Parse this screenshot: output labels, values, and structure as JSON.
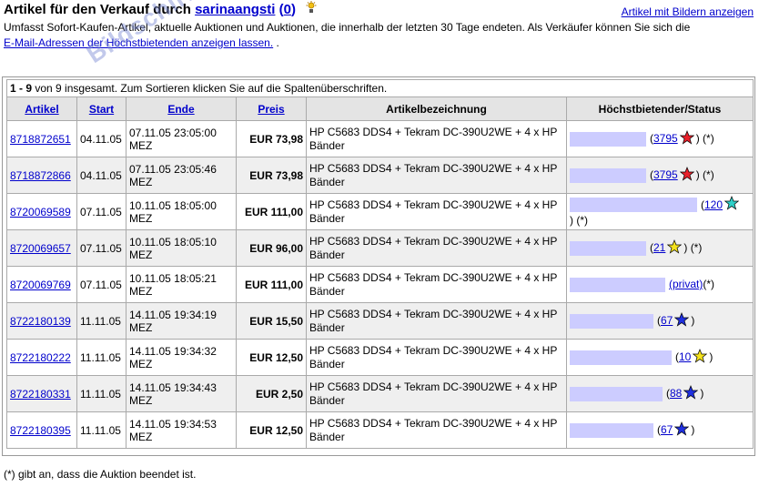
{
  "header": {
    "title_prefix": "Artikel für den Verkauf durch",
    "seller": "sarinaangsti",
    "score_open": "(",
    "score": "0",
    "score_close": ")",
    "pics_link": "Artikel mit Bildern anzeigen",
    "desc_text": "Umfasst Sofort-Kaufen-Artikel, aktuelle Auktionen und Auktionen, die innerhalb der letzten 30 Tage endeten. Als Verkäufer können Sie sich die",
    "email_link": "E-Mail-Adressen der Höchstbietenden anzeigen lassen.",
    "desc_end": "."
  },
  "info": {
    "range": "1 - 9",
    "text": "von 9 insgesamt. Zum Sortieren klicken Sie auf die Spaltenüberschriften."
  },
  "columns": {
    "item": "Artikel",
    "start": "Start",
    "end": "Ende",
    "price": "Preis",
    "title": "Artikelbezeichnung",
    "bidder": "Höchstbietender/Status"
  },
  "rows": [
    {
      "item": "8718872651",
      "start": "04.11.05",
      "end": "07.11.05 23:05:00 MEZ",
      "price": "EUR 73,98",
      "title": "HP C5683 DDS4 + Tekram DC-390U2WE + 4 x HP Bänder",
      "bid_open": "(",
      "rating": "3795",
      "star": "red",
      "bid_tail": ") (*)",
      "bar": 0.6
    },
    {
      "item": "8718872866",
      "start": "04.11.05",
      "end": "07.11.05 23:05:46 MEZ",
      "price": "EUR 73,98",
      "title": "HP C5683 DDS4 + Tekram DC-390U2WE + 4 x HP Bänder",
      "bid_open": "(",
      "rating": "3795",
      "star": "red",
      "bid_tail": ") (*)",
      "bar": 0.6
    },
    {
      "item": "8720069589",
      "start": "07.11.05",
      "end": "10.11.05 18:05:00 MEZ",
      "price": "EUR 111,00",
      "title": "HP C5683 DDS4 + Tekram DC-390U2WE + 4 x HP Bänder",
      "bid_open": "(",
      "rating": "120",
      "star": "turquoise",
      "bid_tail": ") (*)",
      "bar": 1.0
    },
    {
      "item": "8720069657",
      "start": "07.11.05",
      "end": "10.11.05 18:05:10 MEZ",
      "price": "EUR 96,00",
      "title": "HP C5683 DDS4 + Tekram DC-390U2WE + 4 x HP Bänder",
      "bid_open": "(",
      "rating": "21",
      "star": "yellow",
      "bid_tail": ") (*)",
      "bar": 0.6
    },
    {
      "item": "8720069769",
      "start": "07.11.05",
      "end": "10.11.05 18:05:21 MEZ",
      "price": "EUR 111,00",
      "title": "HP C5683 DDS4 + Tekram DC-390U2WE + 4 x HP Bänder",
      "bid_open": "",
      "rating": "(privat)",
      "star": "",
      "bid_tail": "(*)",
      "bar": 0.75
    },
    {
      "item": "8722180139",
      "start": "11.11.05",
      "end": "14.11.05 19:34:19 MEZ",
      "price": "EUR 15,50",
      "title": "HP C5683 DDS4 + Tekram DC-390U2WE + 4 x HP Bänder",
      "bid_open": "(",
      "rating": "67",
      "star": "blue",
      "bid_tail": ")",
      "bar": 0.66
    },
    {
      "item": "8722180222",
      "start": "11.11.05",
      "end": "14.11.05 19:34:32 MEZ",
      "price": "EUR 12,50",
      "title": "HP C5683 DDS4 + Tekram DC-390U2WE + 4 x HP Bänder",
      "bid_open": "(",
      "rating": "10",
      "star": "yellow",
      "bid_tail": ")",
      "bar": 0.8
    },
    {
      "item": "8722180331",
      "start": "11.11.05",
      "end": "14.11.05 19:34:43 MEZ",
      "price": "EUR 2,50",
      "title": "HP C5683 DDS4 + Tekram DC-390U2WE + 4 x HP Bänder",
      "bid_open": "(",
      "rating": "88",
      "star": "blue",
      "bid_tail": ")",
      "bar": 0.73
    },
    {
      "item": "8722180395",
      "start": "11.11.05",
      "end": "14.11.05 19:34:53 MEZ",
      "price": "EUR 12,50",
      "title": "HP C5683 DDS4 + Tekram DC-390U2WE + 4 x HP Bänder",
      "bid_open": "(",
      "rating": "67",
      "star": "blue",
      "bid_tail": ")",
      "bar": 0.66
    }
  ],
  "star_colors": {
    "red": "#e8202a",
    "turquoise": "#2fd0c8",
    "yellow": "#f4e21c",
    "blue": "#1f30e0"
  },
  "bar_color": "#ccccff",
  "footnote": "(*) gibt an, dass die Auktion beendet ist.",
  "watermark": "Bildschirmfoto von der eBay-Auktionsplattform"
}
